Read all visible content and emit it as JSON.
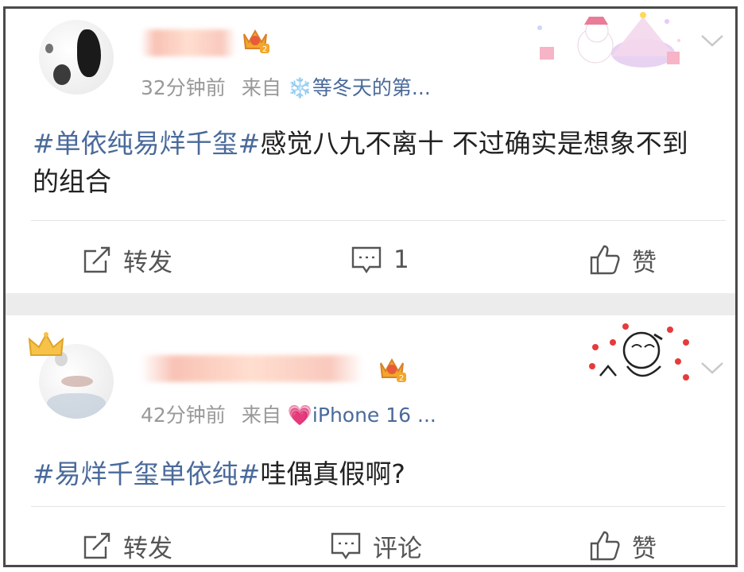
{
  "posts": [
    {
      "time": "32分钟前",
      "from_label": "来自",
      "source_emoji": "❄️",
      "source": "等冬天的第...",
      "hashtag": "#单依纯易烊千玺#",
      "text": "感觉八九不离十 不过确实是想象不到的组合",
      "actions": {
        "repost": "转发",
        "comment": "1",
        "like": "赞"
      }
    },
    {
      "time": "42分钟前",
      "from_label": "来自",
      "source_emoji": "💗",
      "source": "iPhone 16 ...",
      "hashtag": "#易烊千玺单依纯#",
      "text": "哇偶真假啊?",
      "actions": {
        "repost": "转发",
        "comment": "评论",
        "like": "赞"
      }
    }
  ],
  "colors": {
    "link": "#4a6a9a",
    "meta": "#999999",
    "separator": "#ececec"
  },
  "icons": [
    "share-icon",
    "comment-icon",
    "thumbs-up-icon",
    "chevron-down-icon",
    "crown-badge-icon"
  ]
}
